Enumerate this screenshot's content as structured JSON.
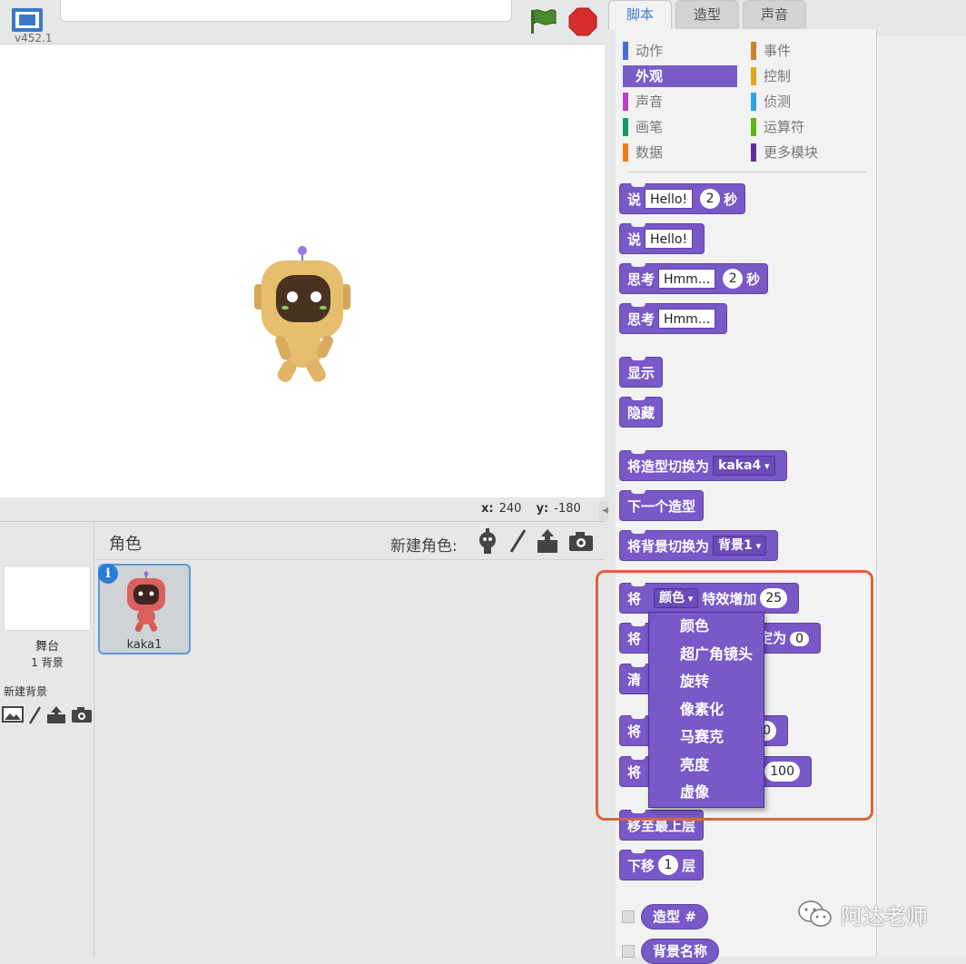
{
  "header": {
    "version": "v452.1",
    "project_title": ""
  },
  "stage": {
    "coords": {
      "x_label": "x:",
      "x_value": "240",
      "y_label": "y:",
      "y_value": "-180"
    }
  },
  "sprite_pane": {
    "stage_label": "舞台",
    "stage_backdrop_count": "1 背景",
    "new_backdrop_label": "新建背景",
    "sprites_label": "角色",
    "new_sprite_label": "新建角色:",
    "sprites": [
      {
        "name": "kaka1",
        "info": "i"
      }
    ]
  },
  "tabs": [
    {
      "label": "脚本"
    },
    {
      "label": "造型"
    },
    {
      "label": "声音"
    }
  ],
  "categories": [
    {
      "label": "动作",
      "color": "#4a6cd4"
    },
    {
      "label": "事件",
      "color": "#c88330"
    },
    {
      "label": "外观",
      "color": "#8a55d7",
      "selected": true
    },
    {
      "label": "控制",
      "color": "#e1a91a"
    },
    {
      "label": "声音",
      "color": "#bb42c3"
    },
    {
      "label": "侦测",
      "color": "#2ca5e2"
    },
    {
      "label": "画笔",
      "color": "#0e9a6c"
    },
    {
      "label": "运算符",
      "color": "#5cb712"
    },
    {
      "label": "数据",
      "color": "#ee7d16"
    },
    {
      "label": "更多模块",
      "color": "#632d99"
    }
  ],
  "blocks": {
    "say_secs": {
      "label": "说",
      "text": "Hello!",
      "secs": "2",
      "unit": "秒"
    },
    "say": {
      "label": "说",
      "text": "Hello!"
    },
    "think_secs": {
      "label": "思考",
      "text": "Hmm...",
      "secs": "2",
      "unit": "秒"
    },
    "think": {
      "label": "思考",
      "text": "Hmm..."
    },
    "show": {
      "label": "显示"
    },
    "hide": {
      "label": "隐藏"
    },
    "switch_costume": {
      "label": "将造型切换为",
      "value": "kaka4"
    },
    "next_costume": {
      "label": "下一个造型"
    },
    "switch_backdrop": {
      "label": "将背景切换为",
      "value": "背景1"
    },
    "change_effect": {
      "label_pre": "将",
      "effect": "颜色",
      "label_post": "特效增加",
      "value": "25"
    },
    "set_effect": {
      "label_pre": "将",
      "label_post": "定为",
      "value": "0"
    },
    "clear_effects": {
      "label": "清"
    },
    "change_size": {
      "label": "将",
      "value": "10"
    },
    "set_size": {
      "label": "将",
      "value": "100"
    },
    "go_front": {
      "label": "移至最上层"
    },
    "go_back": {
      "label": "下移",
      "value": "1",
      "unit": "层"
    },
    "costume_num": {
      "label": "造型 #"
    },
    "backdrop_name": {
      "label": "背景名称"
    }
  },
  "effect_menu": {
    "items": [
      "颜色",
      "超广角镜头",
      "旋转",
      "像素化",
      "马赛克",
      "亮度",
      "虚像"
    ]
  },
  "watermark": {
    "text": "阿达老师"
  },
  "colors": {
    "looks_block": "#7958c8",
    "highlight": "#d9643c",
    "selected_sprite_border": "#5a9bd8"
  }
}
